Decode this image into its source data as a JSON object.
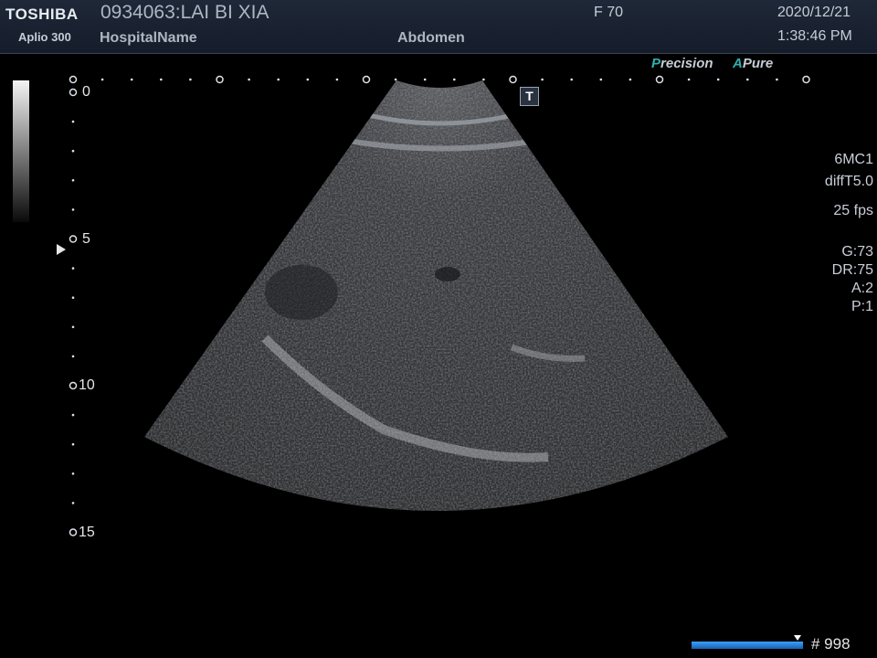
{
  "header": {
    "brand": "TOSHIBA",
    "model": "Aplio 300",
    "patient": "0934063:LAI BI XIA",
    "hospital": "HospitalName",
    "frame_info": "F  70",
    "preset": "Abdomen",
    "date": "2020/12/21",
    "time": "1:38:46 PM"
  },
  "badges": {
    "precision_a": "P",
    "precision_rest": "recision",
    "apure_a": "A",
    "apure_rest": "Pure"
  },
  "depth_scale": {
    "labels": [
      "0",
      "5",
      "10",
      "15"
    ],
    "unit_marks": 15
  },
  "probe_info": {
    "transducer": "6MC1",
    "mode": "diffT5.0",
    "fps": "25 fps",
    "gain": "G:73",
    "dynamic_range": "DR:75",
    "a": "A:2",
    "p": "P:1"
  },
  "t_icon": "T",
  "cine": {
    "frame_count": "# 998",
    "position_fraction": 0.95
  },
  "colors": {
    "header_bg": "#1a2232",
    "accent_teal": "#2eb0b0",
    "cine_blue": "#3aa0ff"
  }
}
